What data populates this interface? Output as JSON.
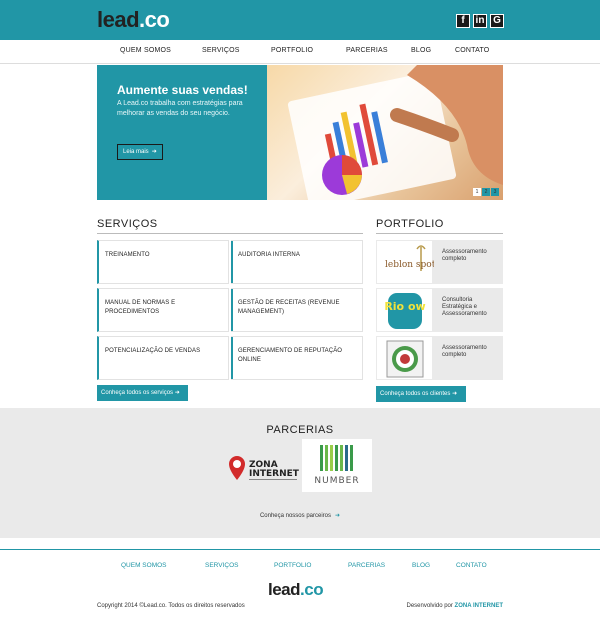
{
  "header": {
    "logo_text": "lead",
    "logo_dot": ".",
    "logo_suffix": "co",
    "social": [
      "f",
      "in",
      "G"
    ]
  },
  "nav": [
    "QUEM SOMOS",
    "SERVIÇOS",
    "PORTFOLIO",
    "PARCERIAS",
    "BLOG",
    "CONTATO"
  ],
  "hero": {
    "title": "Aumente suas vendas!",
    "text": "A Lead.co trabalha com estratégias para melhorar as vendas do seu negócio.",
    "button": "Leia mais",
    "slides": [
      "1",
      "2",
      "3"
    ]
  },
  "services": {
    "heading": "SERVIÇOS",
    "items": [
      "TREINAMENTO",
      "AUDITORIA INTERNA",
      "MANUAL DE NORMAS E PROCEDIMENTOS",
      "GESTÃO DE RECEITAS (REVENUE MANAGEMENT)",
      "POTENCIALIZAÇÃO DE VENDAS",
      "GERENCIAMENTO DE REPUTAÇÃO ONLINE"
    ],
    "button": "Conheça todos os serviços"
  },
  "portfolio": {
    "heading": "PORTFOLIO",
    "items": [
      {
        "logo": "leblon spot",
        "text": "Assessoramento completo"
      },
      {
        "logo": "Rio ow",
        "text": "Consultoria Estratégica e Assessoramento"
      },
      {
        "logo": "",
        "text": "Assessoramento completo"
      }
    ],
    "button": "Conheça todos os clientes"
  },
  "partners": {
    "heading": "PARCERIAS",
    "zona_line1": "ZONA",
    "zona_line2": "INTERNET",
    "number_name": "NUMBER",
    "link": "Conheça nossos parceiros"
  },
  "footer": {
    "nav": [
      "QUEM SOMOS",
      "SERVIÇOS",
      "PORTFOLIO",
      "PARCERIAS",
      "BLOG",
      "CONTATO"
    ],
    "logo_text": "lead",
    "logo_dot": ".",
    "logo_suffix": "co",
    "copyright": "Copyright 2014 ©Lead.co. Todos os direitos reservados",
    "dev_prefix": "Desenvolvido por",
    "dev_name": "ZONA INTERNET"
  },
  "colors": {
    "accent": "#2196a6",
    "partners_bg": "#eaeaea"
  }
}
